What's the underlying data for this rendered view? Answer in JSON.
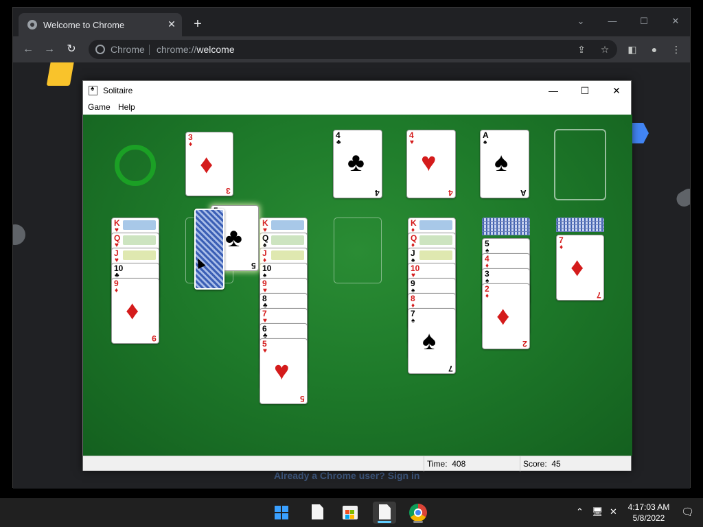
{
  "browser": {
    "tab_title": "Welcome to Chrome",
    "tab_close": "✕",
    "new_tab": "+",
    "address_chip": "Chrome",
    "address_scheme": "chrome://",
    "address_host": "welcome",
    "page_bottom_text": "Already a Chrome user? Sign in"
  },
  "solitaire": {
    "title": "Solitaire",
    "menu": [
      "Game",
      "Help"
    ],
    "status": {
      "time_label": "Time:",
      "time_value": "408",
      "score_label": "Score:",
      "score_value": "45"
    }
  },
  "cards": {
    "waste": {
      "rank": "3",
      "suit": "♦",
      "color": "red"
    },
    "foundations": [
      {
        "rank": "4",
        "suit": "♣",
        "color": "blk"
      },
      {
        "rank": "4",
        "suit": "♥",
        "color": "red"
      },
      {
        "rank": "A",
        "suit": "♠",
        "color": "blk"
      },
      {
        "rank": "",
        "suit": "",
        "color": ""
      }
    ],
    "dragging": {
      "rank": "5",
      "suit": "♣",
      "color": "blk"
    },
    "tableau": [
      [
        {
          "r": "K",
          "s": "♥",
          "c": "red"
        },
        {
          "r": "Q",
          "s": "♥",
          "c": "red"
        },
        {
          "r": "J",
          "s": "♥",
          "c": "red"
        },
        {
          "r": "10",
          "s": "♣",
          "c": "blk"
        },
        {
          "r": "9",
          "s": "♦",
          "c": "red"
        }
      ],
      [],
      [
        {
          "r": "K",
          "s": "♥",
          "c": "red"
        },
        {
          "r": "Q",
          "s": "♠",
          "c": "blk"
        },
        {
          "r": "J",
          "s": "♦",
          "c": "red"
        },
        {
          "r": "10",
          "s": "♠",
          "c": "blk"
        },
        {
          "r": "9",
          "s": "♥",
          "c": "red"
        },
        {
          "r": "8",
          "s": "♣",
          "c": "blk"
        },
        {
          "r": "7",
          "s": "♥",
          "c": "red"
        },
        {
          "r": "6",
          "s": "♣",
          "c": "blk"
        },
        {
          "r": "5",
          "s": "♥",
          "c": "red"
        }
      ],
      [],
      [
        {
          "r": "K",
          "s": "♦",
          "c": "red"
        },
        {
          "r": "Q",
          "s": "♦",
          "c": "red"
        },
        {
          "r": "J",
          "s": "♠",
          "c": "blk"
        },
        {
          "r": "10",
          "s": "♥",
          "c": "red"
        },
        {
          "r": "9",
          "s": "♠",
          "c": "blk"
        },
        {
          "r": "8",
          "s": "♦",
          "c": "red"
        },
        {
          "r": "7",
          "s": "♠",
          "c": "blk"
        }
      ],
      [
        {
          "r": "5",
          "s": "♠",
          "c": "blk"
        },
        {
          "r": "4",
          "s": "♦",
          "c": "red"
        },
        {
          "r": "3",
          "s": "♠",
          "c": "blk"
        },
        {
          "r": "2",
          "s": "♦",
          "c": "red"
        }
      ],
      [
        {
          "r": "7",
          "s": "♦",
          "c": "red"
        }
      ]
    ]
  },
  "taskbar": {
    "clock_time": "4:17:03 AM",
    "clock_date": "5/8/2022"
  }
}
